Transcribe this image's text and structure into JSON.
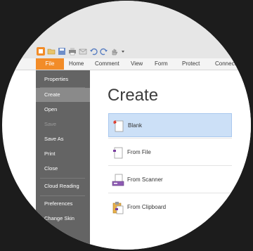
{
  "menu": {
    "tabs": [
      "File",
      "Home",
      "Comment",
      "View",
      "Form",
      "Protect",
      "Connect"
    ]
  },
  "sidebar": {
    "items": [
      {
        "label": "Properties"
      },
      {
        "label": "Create"
      },
      {
        "label": "Open"
      },
      {
        "label": "Save"
      },
      {
        "label": "Save As"
      },
      {
        "label": "Print"
      },
      {
        "label": "Close"
      },
      {
        "label": "Cloud Reading"
      },
      {
        "label": "Preferences"
      },
      {
        "label": "Change Skin"
      }
    ]
  },
  "main": {
    "title": "Create",
    "options": [
      {
        "label": "Blank",
        "icon": "blank-document-icon"
      },
      {
        "label": "From File",
        "icon": "from-file-icon"
      },
      {
        "label": "From Scanner",
        "icon": "scanner-icon"
      },
      {
        "label": "From Clipboard",
        "icon": "clipboard-icon"
      }
    ]
  },
  "colors": {
    "file_tab": "#f28c28",
    "sidebar": "#646464",
    "sidebar_active": "#8a8a8a",
    "selected_option": "#cce0f7"
  }
}
